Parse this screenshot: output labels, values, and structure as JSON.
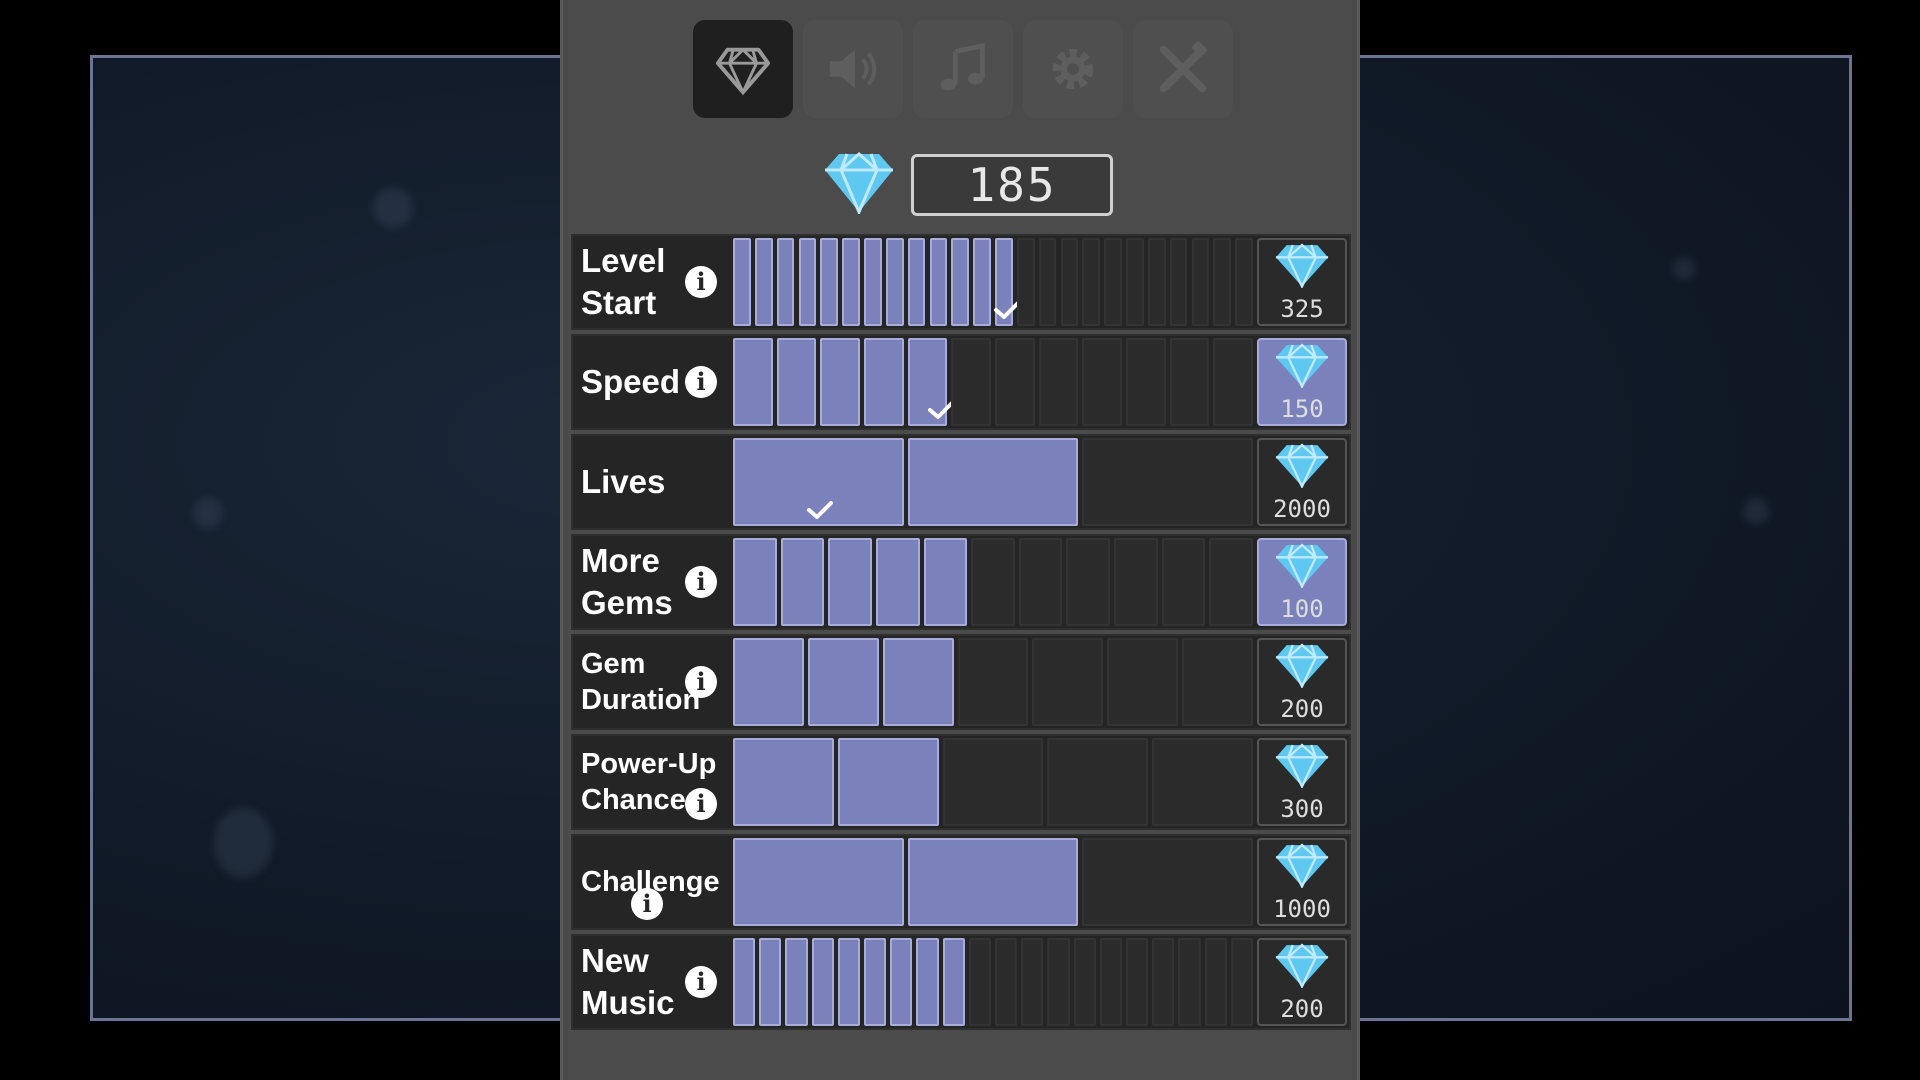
{
  "tabs": [
    {
      "name": "gems",
      "icon": "gem-icon",
      "active": true
    },
    {
      "name": "sound",
      "icon": "speaker-icon",
      "active": false
    },
    {
      "name": "music",
      "icon": "music-note-icon",
      "active": false
    },
    {
      "name": "settings",
      "icon": "gear-icon",
      "active": false
    },
    {
      "name": "tools",
      "icon": "tools-icon",
      "active": false
    }
  ],
  "gems": {
    "count": "185"
  },
  "colors": {
    "filled": "#7b82bb",
    "empty": "#2b2b2b",
    "gem": "#5fc8f0",
    "panel": "#4b4b4b"
  },
  "upgrades": [
    {
      "label_lines": [
        "Level",
        "Start"
      ],
      "info": true,
      "segments_total": 24,
      "segments_filled": 13,
      "check_index": 12,
      "price": "325",
      "affordable": false
    },
    {
      "label_lines": [
        "Speed"
      ],
      "info": true,
      "segments_total": 12,
      "segments_filled": 5,
      "check_index": 4,
      "price": "150",
      "affordable": true
    },
    {
      "label_lines": [
        "Lives"
      ],
      "info": false,
      "segments_total": 3,
      "segments_filled": 2,
      "check_index": 0,
      "price": "2000",
      "affordable": false
    },
    {
      "label_lines": [
        "More",
        "Gems"
      ],
      "info": true,
      "segments_total": 11,
      "segments_filled": 5,
      "check_index": -1,
      "price": "100",
      "affordable": true
    },
    {
      "label_lines": [
        "Gem",
        "Duration"
      ],
      "info": true,
      "segments_total": 7,
      "segments_filled": 3,
      "check_index": -1,
      "price": "200",
      "affordable": false
    },
    {
      "label_lines": [
        "Power-Up",
        "Chance"
      ],
      "info": true,
      "segments_total": 5,
      "segments_filled": 2,
      "check_index": -1,
      "price": "300",
      "affordable": false
    },
    {
      "label_lines": [
        "Challenge"
      ],
      "info": true,
      "segments_total": 3,
      "segments_filled": 2,
      "check_index": -1,
      "price": "1000",
      "affordable": false
    },
    {
      "label_lines": [
        "New",
        "Music"
      ],
      "info": true,
      "segments_total": 20,
      "segments_filled": 9,
      "check_index": -1,
      "price": "200",
      "affordable": false
    }
  ]
}
